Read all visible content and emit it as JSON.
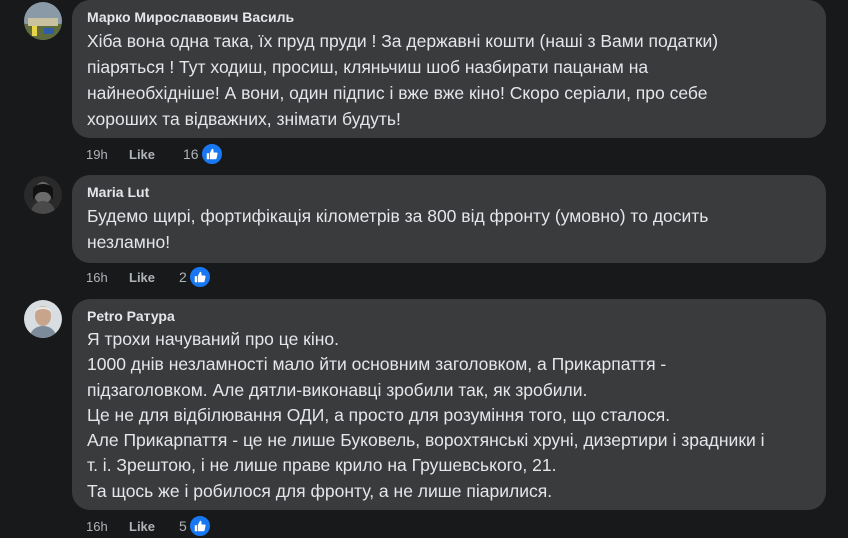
{
  "comments": [
    {
      "author": "Марко Мирославович Василь",
      "lines": [
        "Хіба вона одна така, їх пруд пруди ! За державні кошти (наші з Вами податки)",
        "піаряться ! Тут ходиш, просиш, кляньчиш шоб назбирати пацанам на",
        "найнеобхідніше! А вони, один підпис і вже вже кіно! Скоро серіали, про себе",
        "хороших та відважних, знімати будуть!"
      ],
      "time": "19h",
      "like_label": "Like",
      "reaction_count": "16",
      "reaction_icon": "like-icon"
    },
    {
      "author": "Maria Lut",
      "lines": [
        "Будемо щирі, фортифікація кілометрів за 800 від фронту (умовно) то досить",
        "незламно!"
      ],
      "time": "16h",
      "like_label": "Like",
      "reaction_count": "2",
      "reaction_icon": "like-icon"
    },
    {
      "author": "Petro Ратура",
      "lines": [
        "Я трохи начуваний про це кіно.",
        "1000 днів незламності мало йти основним заголовком, а Прикарпаття -",
        "підзаголовком. Але дятли-виконавці зробили так, як зробили.",
        "Це не для відбілювання ОДИ, а просто для розуміння того, що сталося.",
        "Але Прикарпаття - це не лише Буковель, ворохтянські хруні, дизертири і зрадники і",
        "т. і. Зрештою, і не лише праве крило на Грушевського, 21.",
        "Та щось же і робилося для фронту, а не лише піарилися."
      ],
      "time": "16h",
      "like_label": "Like",
      "reaction_count": "5",
      "reaction_icon": "like-icon"
    }
  ],
  "colors": {
    "background": "#18191a",
    "bubble": "#3a3b3c",
    "text": "#e4e6eb",
    "secondary_text": "#b0b3b8",
    "like_blue": "#1877f2"
  }
}
